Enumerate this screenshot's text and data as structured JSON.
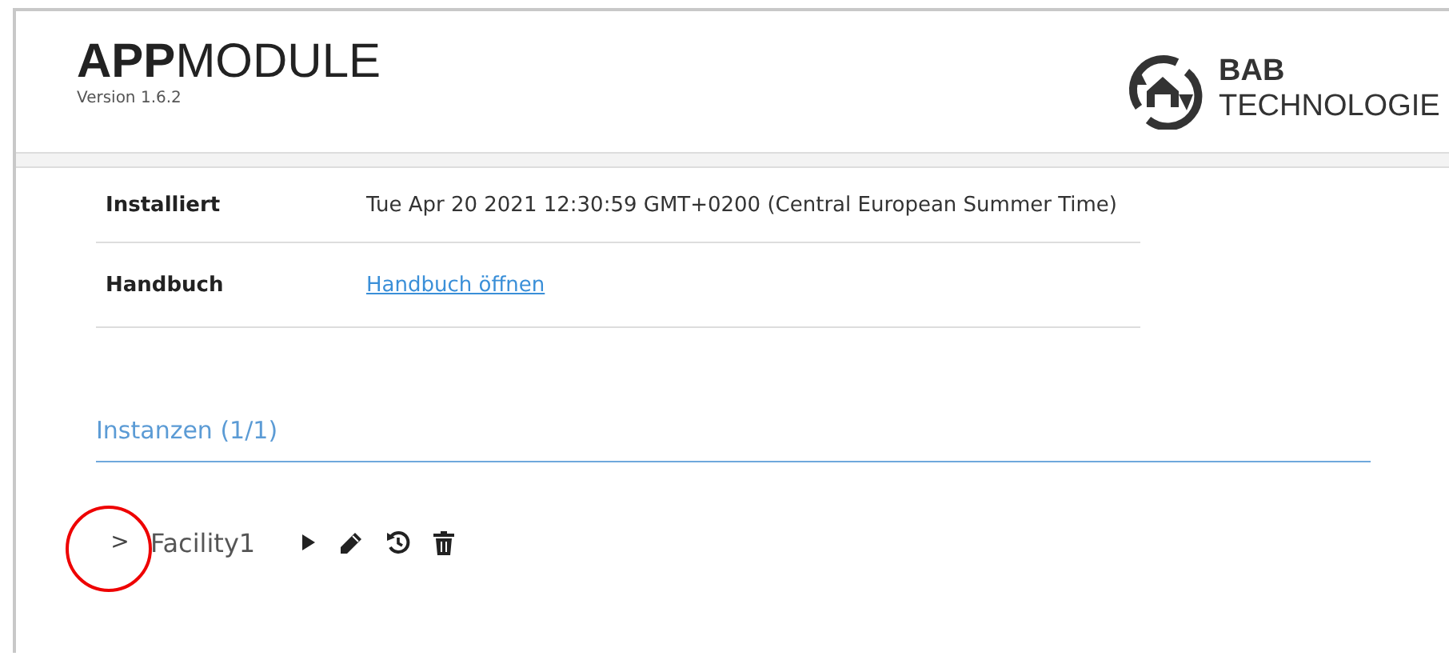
{
  "header": {
    "title": "**APP**MODULE",
    "version": "Version 1.6.2",
    "logo": {
      "line_1": "BAB",
      "line_2": "TECHNOLOGIE"
    }
  },
  "info": [
    {
      "label": "Installiert",
      "value": "Tue Apr 20 2021 12:30:59 GMT+0200 (Central European Summer Time)",
      "kind": "text"
    },
    {
      "label": "Handbuch",
      "value": "Handbuch öffnen",
      "kind": "link"
    }
  ],
  "instances": {
    "heading": "Instanzen (1/1)",
    "items": [
      {
        "chevron": ">",
        "name": "Facility1",
        "expanded": false,
        "highlighted": true
      }
    ]
  }
}
